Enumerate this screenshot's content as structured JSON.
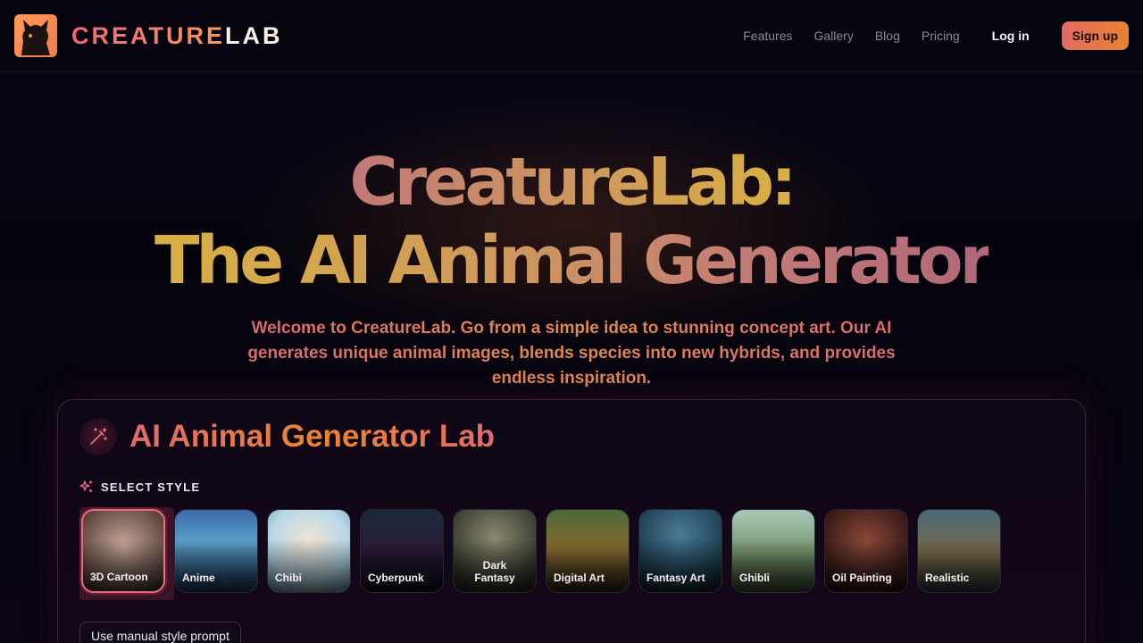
{
  "header": {
    "brand_part1": "CREATURE",
    "brand_part2": "LAB",
    "nav": [
      "Features",
      "Gallery",
      "Blog",
      "Pricing"
    ],
    "login": "Log in",
    "signup": "Sign up"
  },
  "hero": {
    "title_line1": "CreatureLab:",
    "title_line2": "The AI Animal Generator",
    "subtitle": "Welcome to CreatureLab. Go from a simple idea to stunning concept art. Our AI generates unique animal images, blends species into new hybrids, and provides endless inspiration."
  },
  "lab": {
    "title": "AI Animal Generator Lab",
    "select_style_label": "SELECT STYLE",
    "styles": [
      {
        "label": "3D Cartoon",
        "selected": true
      },
      {
        "label": "Anime",
        "selected": false
      },
      {
        "label": "Chibi",
        "selected": false
      },
      {
        "label": "Cyberpunk",
        "selected": false
      },
      {
        "label": "Dark Fantasy",
        "selected": false
      },
      {
        "label": "Digital Art",
        "selected": false
      },
      {
        "label": "Fantasy Art",
        "selected": false
      },
      {
        "label": "Ghibli",
        "selected": false
      },
      {
        "label": "Oil Painting",
        "selected": false
      },
      {
        "label": "Realistic",
        "selected": false
      }
    ],
    "manual_prompt_button": "Use manual style prompt"
  },
  "colors": {
    "background": "#05040d",
    "accent_pink": "#e06a70",
    "accent_orange": "#e8832f",
    "gold": "#d8b042"
  },
  "icons": [
    "creature-logo-icon",
    "magic-wand-icon",
    "sparkles-icon"
  ]
}
